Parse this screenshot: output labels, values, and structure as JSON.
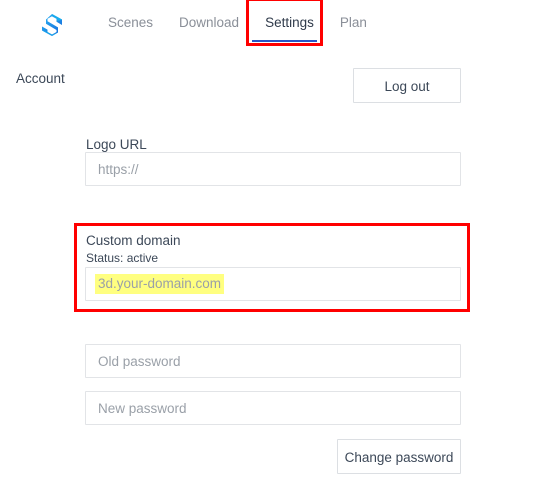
{
  "header": {
    "logo_icon": "hexagon-s-logo-icon",
    "nav": [
      {
        "label": "Scenes",
        "active": false
      },
      {
        "label": "Download",
        "active": false
      },
      {
        "label": "Settings",
        "active": true
      },
      {
        "label": "Plan",
        "active": false
      }
    ]
  },
  "account": {
    "section_label": "Account",
    "logout_button": "Log out"
  },
  "logo_url": {
    "label": "Logo URL",
    "placeholder": "https://",
    "value": ""
  },
  "custom_domain": {
    "label": "Custom domain",
    "status": "Status: active",
    "placeholder": "3d.your-domain.com",
    "value": "",
    "highlight_color": "#ffff80"
  },
  "password": {
    "old_placeholder": "Old password",
    "old_value": "",
    "new_placeholder": "New password",
    "new_value": "",
    "change_button": "Change password"
  },
  "annotations": {
    "color": "#ff0000",
    "settings_tab_box": "settings-tab-highlight",
    "custom_domain_box": "custom-domain-highlight"
  },
  "colors": {
    "accent": "#2a56c6",
    "text": "#3c4858",
    "muted": "#8a8f98",
    "border": "#e2e4e7"
  }
}
